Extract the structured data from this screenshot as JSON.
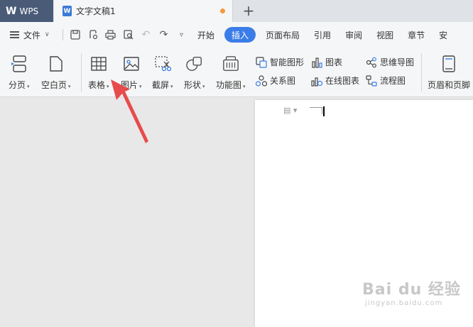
{
  "titlebar": {
    "app_name": "WPS",
    "document_tab": "文字文稿1",
    "new_tab": "+"
  },
  "menubar": {
    "file_label": "文件",
    "tabs": [
      "开始",
      "插入",
      "页面布局",
      "引用",
      "审阅",
      "视图",
      "章节",
      "安"
    ],
    "active_tab": "插入"
  },
  "ribbon": {
    "big_buttons": {
      "page_break": "分页",
      "blank_page": "空白页",
      "table": "表格",
      "picture": "图片",
      "screenshot": "截屏",
      "shapes": "形状",
      "function_chart": "功能图",
      "header_footer": "页眉和页脚"
    },
    "small_buttons": {
      "smart_art": "智能图形",
      "chart": "图表",
      "mind_map": "思维导图",
      "relation": "关系图",
      "online_chart": "在线图表",
      "flowchart": "流程图"
    }
  },
  "watermark": {
    "main": "Bai du 经验",
    "sub": "jingyan.baidu.com"
  },
  "colors": {
    "accent": "#3b7de8",
    "wps_tab": "#4a5b78",
    "arrow": "#e84b4b",
    "modified_dot": "#f39a3b"
  }
}
